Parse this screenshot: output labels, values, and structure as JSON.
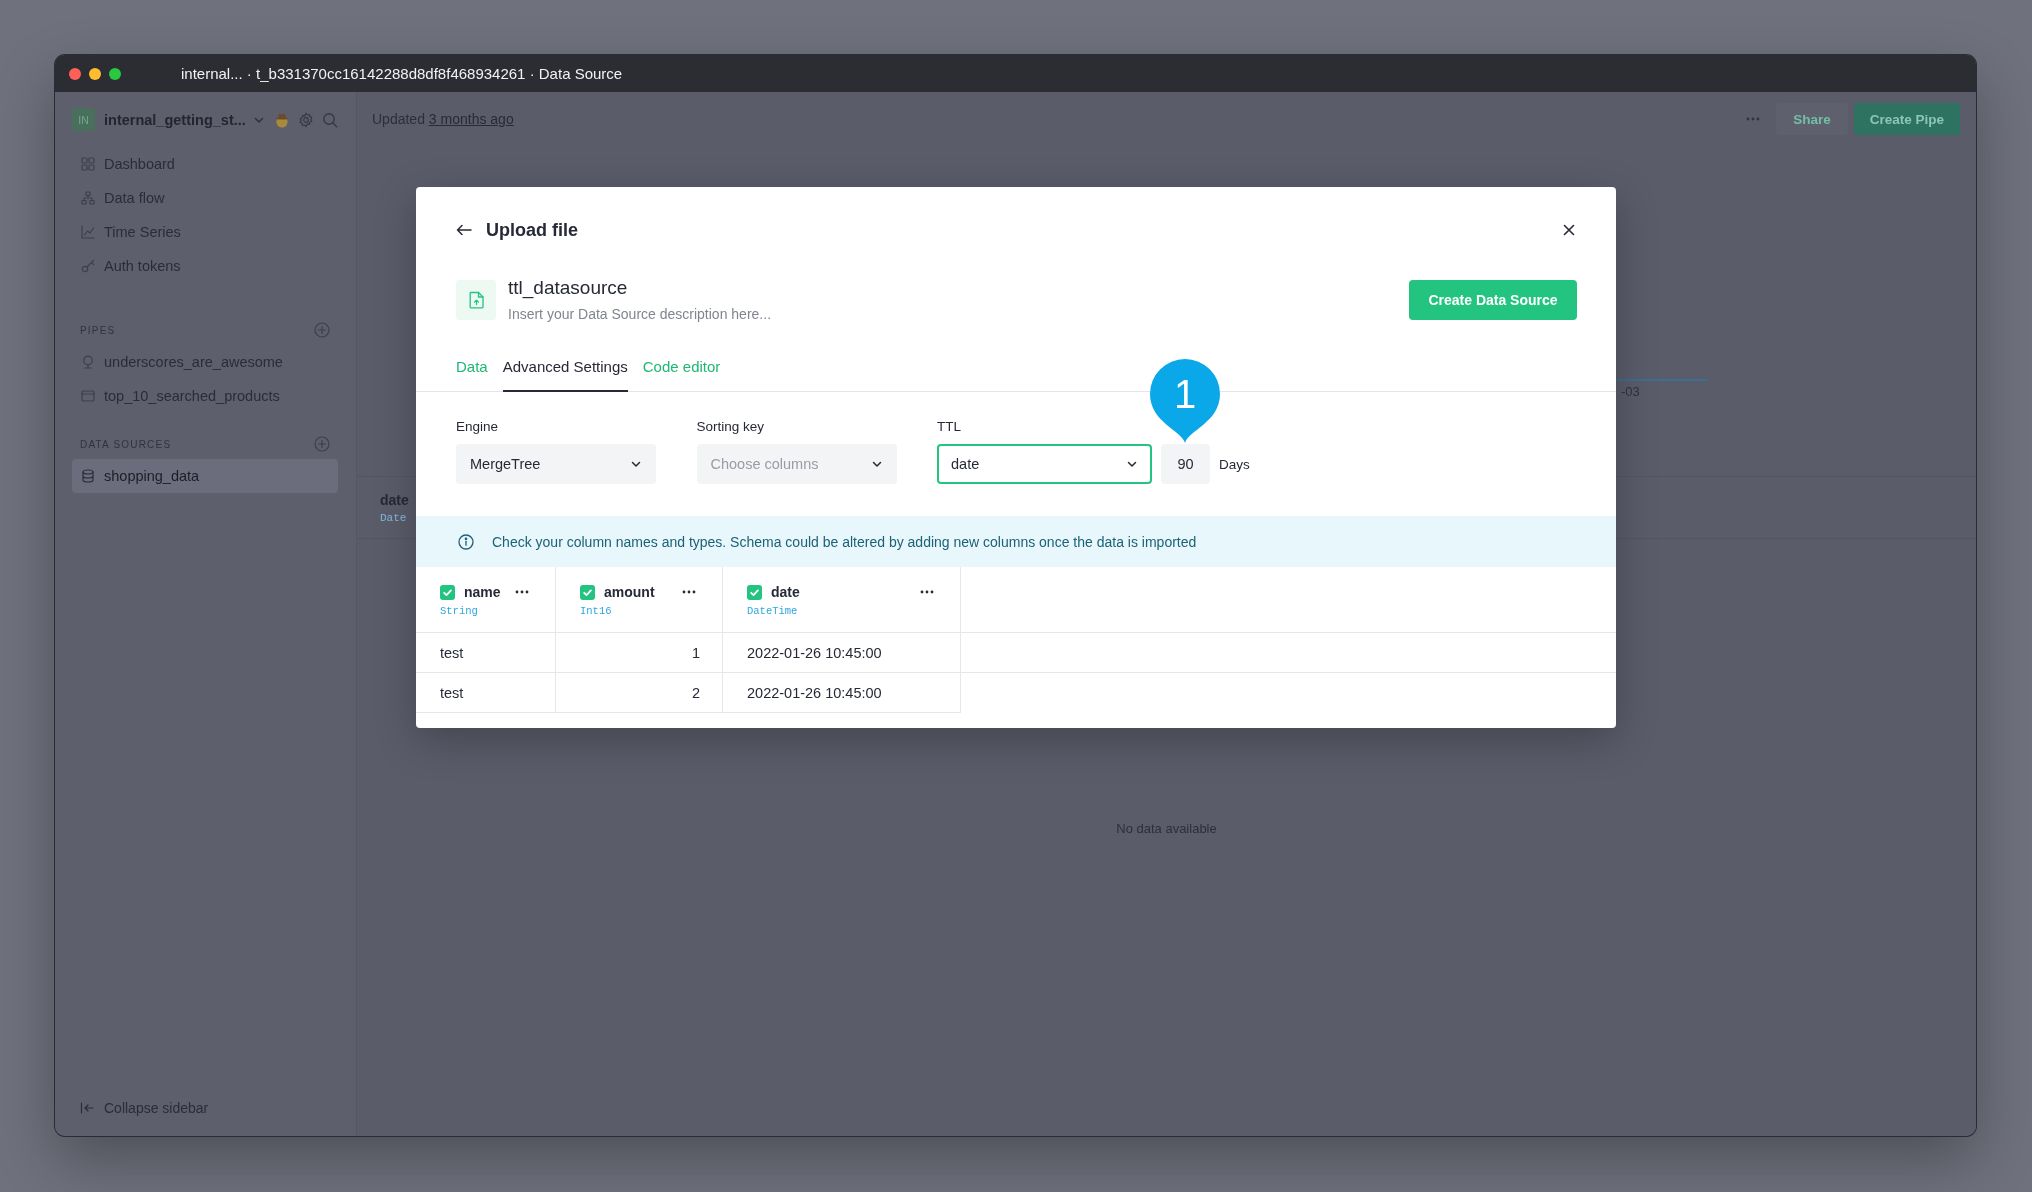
{
  "window": {
    "title": "internal... · t_b331370cc16142288d8df8f468934261 · Data Source"
  },
  "sidebar": {
    "workspace": {
      "initials": "IN",
      "name": "internal_getting_st..."
    },
    "nav": [
      {
        "label": "Dashboard",
        "kind": "dashboard"
      },
      {
        "label": "Data flow",
        "kind": "flow"
      },
      {
        "label": "Time Series",
        "kind": "series"
      },
      {
        "label": "Auth tokens",
        "kind": "tokens"
      }
    ],
    "sections": [
      {
        "title": "PIPES",
        "items": [
          {
            "label": "underscores_are_awesome",
            "kind": "endpoint",
            "selected": false
          },
          {
            "label": "top_10_searched_products",
            "kind": "pipe",
            "selected": false
          }
        ]
      },
      {
        "title": "DATA SOURCES",
        "items": [
          {
            "label": "shopping_data",
            "kind": "datasource",
            "selected": true
          }
        ]
      }
    ],
    "collapse": {
      "label": "Collapse sidebar"
    }
  },
  "header": {
    "updated": {
      "prefix": "Updated",
      "link": "3 months ago"
    },
    "buttons": [
      {
        "label": "Share",
        "kind": "secondary"
      },
      {
        "label": "Create Pipe",
        "kind": "primary"
      }
    ]
  },
  "background": {
    "axis_label": "-03",
    "schema_column": {
      "name": "date",
      "type": "Date"
    },
    "empty_state": "No data available"
  },
  "modal": {
    "title": "Upload file",
    "datasource": {
      "name": "ttl_datasource",
      "description_placeholder": "Insert your Data Source description here..."
    },
    "create_button": "Create Data Source",
    "tabs": [
      {
        "label": "Data",
        "selected": false
      },
      {
        "label": "Advanced Settings",
        "selected": true
      },
      {
        "label": "Code editor",
        "selected": false
      }
    ],
    "settings": [
      {
        "label": "Engine",
        "value": "MergeTree",
        "focused": false
      },
      {
        "label": "Sorting key",
        "placeholder": "Choose columns",
        "focused": false
      },
      {
        "label": "TTL",
        "value": "date",
        "focused": true,
        "period": {
          "value": "90",
          "unit": "Days"
        }
      }
    ],
    "info": "Check your column names and types. Schema could be altered by adding new columns once the data is imported",
    "table": {
      "columns": [
        {
          "name": "name",
          "type": "String",
          "checked": true,
          "kind": "text"
        },
        {
          "name": "amount",
          "type": "Int16",
          "checked": true,
          "kind": "number"
        },
        {
          "name": "date",
          "type": "DateTime",
          "checked": true,
          "kind": "text"
        }
      ],
      "rows": [
        [
          "test",
          "1",
          "2022-01-26 10:45:00"
        ],
        [
          "test",
          "2",
          "2022-01-26 10:45:00"
        ]
      ]
    }
  },
  "annotation": {
    "label": "1"
  }
}
